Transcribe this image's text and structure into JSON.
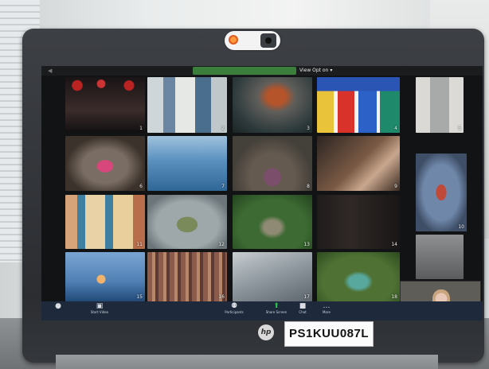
{
  "webcam_cover": {
    "brand_text": ""
  },
  "screen": {
    "view_option_label": "View Opt on ▾",
    "tiles": [
      {
        "num": "1",
        "bg": "radial-gradient(circle at 15% 15%,#b22 0 6%,transparent 7%),radial-gradient(circle at 45% 12%,#c33 0 6%,transparent 7%),radial-gradient(circle at 80% 15%,#b22 0 6%,transparent 7%),linear-gradient(180deg,#1a1416,#3a2c2a 60%,#121012)"
      },
      {
        "num": "2",
        "bg": "linear-gradient(90deg,#cfd6d9 0 20%,#6b86a3 20% 35%,#e6e8e6 35% 60%,#4a6f8e 60% 80%,#bfc7cb 80%)"
      },
      {
        "num": "3",
        "bg": "radial-gradient(ellipse at 55% 35%,#b5542a 0 15%,#5f5e5a 30%,#2d3a3c 70%,#1b2424)"
      },
      {
        "num": "4",
        "bg": "linear-gradient(180deg,#2a55b5 0 25%,transparent 25%),linear-gradient(90deg,#e9c33a 0 20%,#f4f4f4 20% 25%,#d8322a 25% 45%,#f4f4f4 45% 50%,#2c62c7 50% 72%,#f4f4f4 72% 76%,#1f8a6b 76% 100%)"
      },
      {
        "num": "5",
        "bg": "linear-gradient(90deg,#dbd9d6 0 30%,#a8aaa9 30% 70%,#dcdad7 70%)"
      },
      {
        "num": "6",
        "bg": "radial-gradient(ellipse at 50% 55%,#d8477c 0 14%,#7a6d63 15% 40%,#3b322b 70%)"
      },
      {
        "num": "7",
        "bg": "linear-gradient(180deg,#9fc2de,#5a90be 45%,#2f6797)"
      },
      {
        "num": "8",
        "bg": "radial-gradient(ellipse at 50% 75%,#7b4e6c 0 15%,#655a4f 16% 40%,#44403a 70%)"
      },
      {
        "num": "9",
        "bg": "linear-gradient(135deg,#2c2522,#7a5a45 50%,#c9a78e 70%,#3a2a22)"
      },
      {
        "num": "10",
        "bg": "radial-gradient(ellipse at 50% 50%,#c04a3a 0 14%,#6f87a9 15% 50%,#3e4e66 75%)"
      },
      {
        "num": "11",
        "bg": "linear-gradient(90deg,#d7a47a 0 15%,#3f7fa0 15% 25%,#e8d2a6 25% 50%,#3f7fa0 50% 60%,#e8cf9b 60% 85%,#b86e4a 85%)"
      },
      {
        "num": "12",
        "bg": "radial-gradient(ellipse at 50% 55%,#7a8a5a 0 18%,#9ea7aa 19% 55%,#6c7579 80%)"
      },
      {
        "num": "13",
        "bg": "radial-gradient(ellipse at 50% 60%,#8e8a73 0 15%,#3c6a32 25% 60%,#23421f)"
      },
      {
        "num": "14",
        "bg": "linear-gradient(90deg,#201c1b,#2f2826 40%,#1a1616)"
      },
      {
        "num": "15",
        "bg": "radial-gradient(circle at 45% 55%,#f1b36b 0 8%,transparent 9%),linear-gradient(180deg,#7aa5d2,#4f7fb4 60%,#224a78)"
      },
      {
        "num": "16",
        "bg": "repeating-linear-gradient(90deg,#8d5b4a 0 6px,#b7876b 6px 10px,#5d3b34 10px 14px)"
      },
      {
        "num": "17",
        "bg": "linear-gradient(160deg,#c8cdd1,#8d979d 50%,#5d666c)"
      },
      {
        "num": "18",
        "bg": "radial-gradient(ellipse at 50% 60%,#58a89e 0 16%,#4f7234 25% 60%,#2d4a1f)"
      },
      {
        "num": "",
        "bg": "linear-gradient(180deg,#8f9092,#5b5c5e)"
      }
    ]
  },
  "toolbar": {
    "items": [
      {
        "label": "",
        "icon": "●"
      },
      {
        "label": "Start Video",
        "icon": "▣"
      },
      {
        "label": "Participants",
        "icon": "⚉"
      },
      {
        "label": "Share Screen",
        "icon": "⬆"
      },
      {
        "label": "Chat",
        "icon": "■"
      },
      {
        "label": "More",
        "icon": "…"
      }
    ]
  },
  "asset_tag": "PS1KUU087L",
  "hp_logo": "hp"
}
